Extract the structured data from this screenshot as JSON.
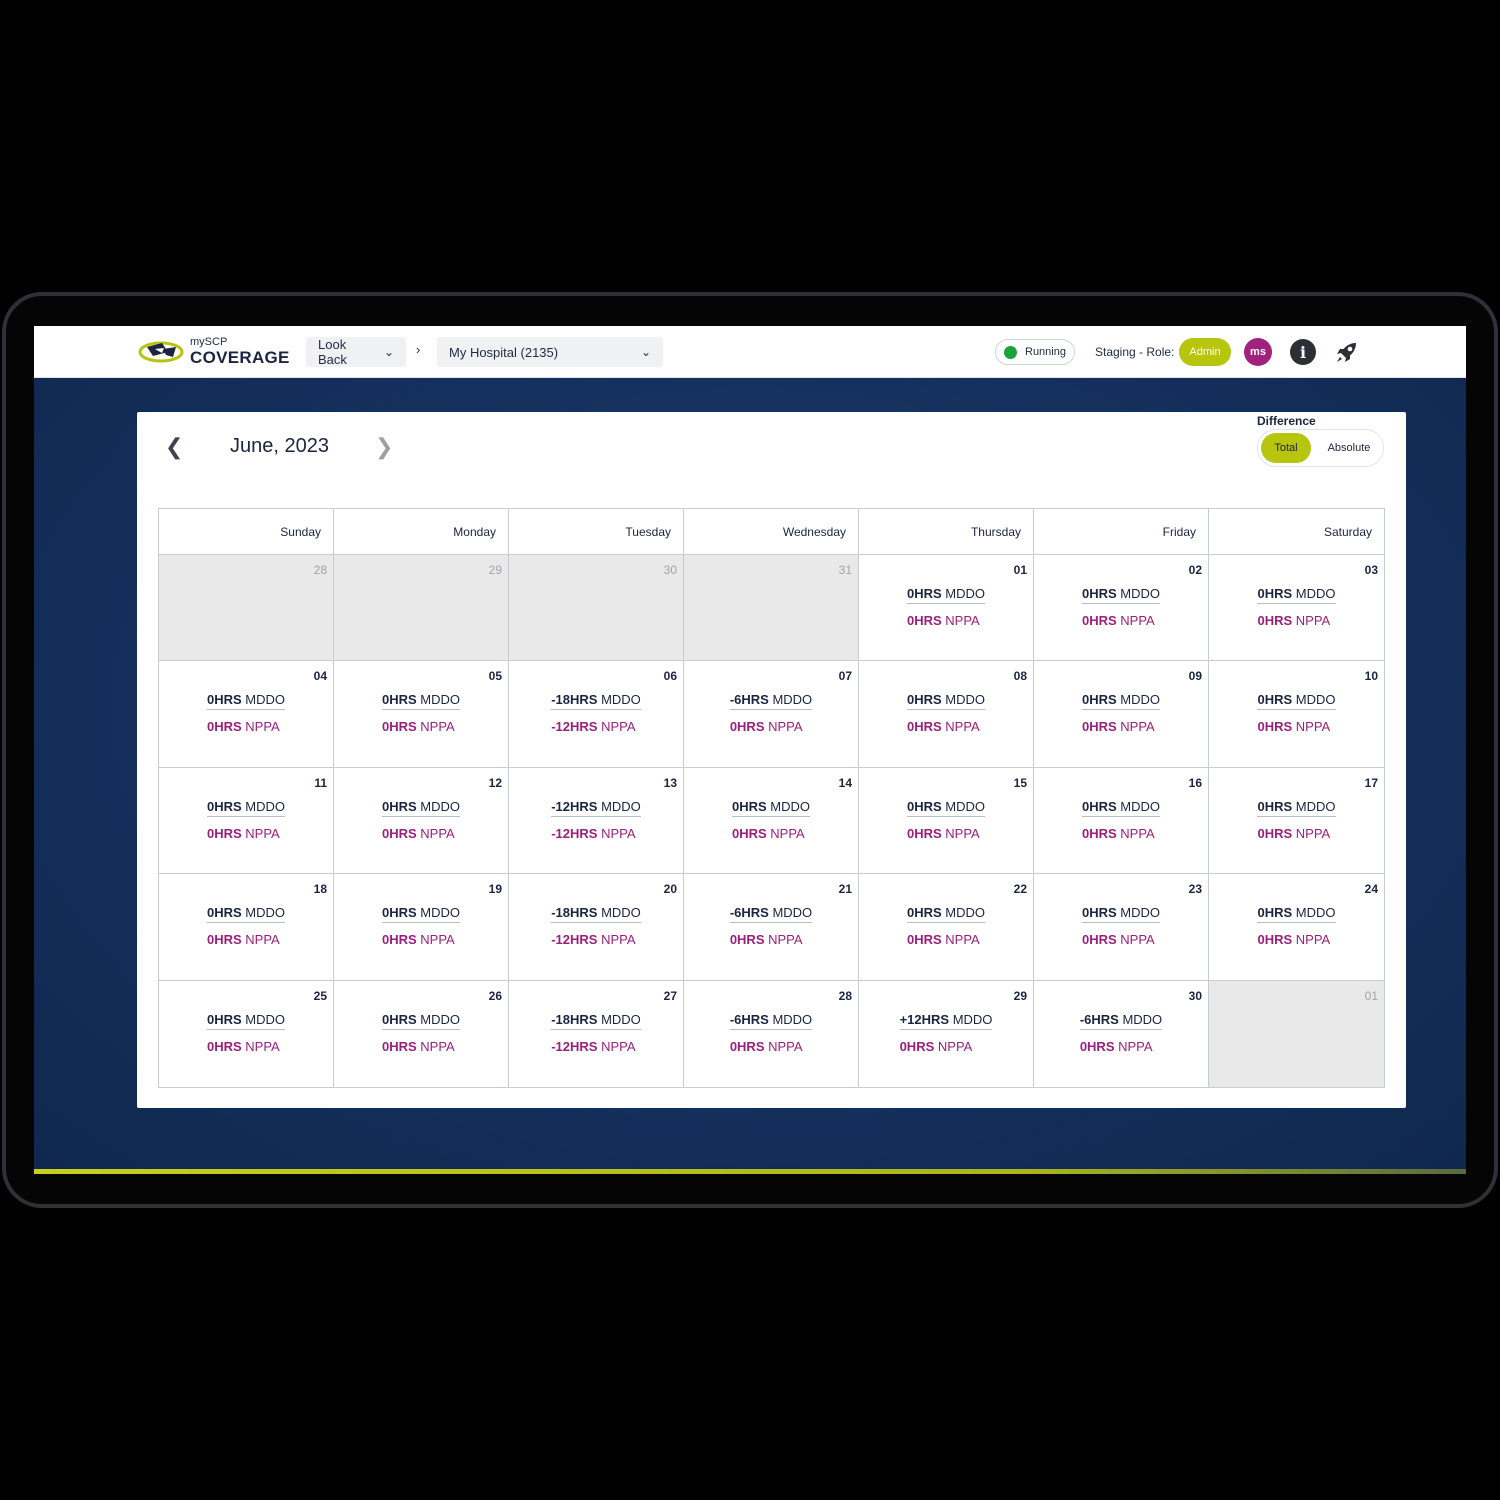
{
  "app": {
    "logo_small": "mySCP",
    "logo_big": "COVERAGE"
  },
  "topbar": {
    "lookback_label": "Look Back",
    "crumb_sep": "›",
    "hospital_label": "My Hospital (2135)",
    "status": "Running",
    "role_label": "Staging - Role:",
    "role_value": "Admin",
    "user_initials": "ms",
    "info_glyph": "i"
  },
  "calendar": {
    "month_label": "June, 2023",
    "difference_label": "Difference",
    "toggle_total": "Total",
    "toggle_absolute": "Absolute",
    "weekdays": [
      "Sunday",
      "Monday",
      "Tuesday",
      "Wednesday",
      "Thursday",
      "Friday",
      "Saturday"
    ],
    "mddo_suffix": "MDDO",
    "nppa_suffix": "NPPA",
    "days": [
      {
        "day": "28",
        "out": true
      },
      {
        "day": "29",
        "out": true
      },
      {
        "day": "30",
        "out": true
      },
      {
        "day": "31",
        "out": true
      },
      {
        "day": "01",
        "mddo": "0HRS",
        "nppa": "0HRS"
      },
      {
        "day": "02",
        "mddo": "0HRS",
        "nppa": "0HRS"
      },
      {
        "day": "03",
        "mddo": "0HRS",
        "nppa": "0HRS"
      },
      {
        "day": "04",
        "mddo": "0HRS",
        "nppa": "0HRS"
      },
      {
        "day": "05",
        "mddo": "0HRS",
        "nppa": "0HRS"
      },
      {
        "day": "06",
        "mddo": "-18HRS",
        "nppa": "-12HRS"
      },
      {
        "day": "07",
        "mddo": "-6HRS",
        "nppa": "0HRS"
      },
      {
        "day": "08",
        "mddo": "0HRS",
        "nppa": "0HRS"
      },
      {
        "day": "09",
        "mddo": "0HRS",
        "nppa": "0HRS"
      },
      {
        "day": "10",
        "mddo": "0HRS",
        "nppa": "0HRS"
      },
      {
        "day": "11",
        "mddo": "0HRS",
        "nppa": "0HRS"
      },
      {
        "day": "12",
        "mddo": "0HRS",
        "nppa": "0HRS"
      },
      {
        "day": "13",
        "mddo": "-12HRS",
        "nppa": "-12HRS"
      },
      {
        "day": "14",
        "mddo": "0HRS",
        "nppa": "0HRS"
      },
      {
        "day": "15",
        "mddo": "0HRS",
        "nppa": "0HRS"
      },
      {
        "day": "16",
        "mddo": "0HRS",
        "nppa": "0HRS"
      },
      {
        "day": "17",
        "mddo": "0HRS",
        "nppa": "0HRS"
      },
      {
        "day": "18",
        "mddo": "0HRS",
        "nppa": "0HRS"
      },
      {
        "day": "19",
        "mddo": "0HRS",
        "nppa": "0HRS"
      },
      {
        "day": "20",
        "mddo": "-18HRS",
        "nppa": "-12HRS"
      },
      {
        "day": "21",
        "mddo": "-6HRS",
        "nppa": "0HRS"
      },
      {
        "day": "22",
        "mddo": "0HRS",
        "nppa": "0HRS"
      },
      {
        "day": "23",
        "mddo": "0HRS",
        "nppa": "0HRS"
      },
      {
        "day": "24",
        "mddo": "0HRS",
        "nppa": "0HRS"
      },
      {
        "day": "25",
        "mddo": "0HRS",
        "nppa": "0HRS"
      },
      {
        "day": "26",
        "mddo": "0HRS",
        "nppa": "0HRS"
      },
      {
        "day": "27",
        "mddo": "-18HRS",
        "nppa": "-12HRS"
      },
      {
        "day": "28",
        "mddo": "-6HRS",
        "nppa": "0HRS"
      },
      {
        "day": "29",
        "mddo": "+12HRS",
        "nppa": "0HRS"
      },
      {
        "day": "30",
        "mddo": "-6HRS",
        "nppa": "0HRS"
      },
      {
        "day": "01",
        "out": true
      }
    ]
  },
  "colors": {
    "accent": "#b8c50e",
    "nppa": "#9b1f7c",
    "navy": "#1b2540",
    "running": "#1aa33a",
    "avatar": "#a2207e"
  }
}
